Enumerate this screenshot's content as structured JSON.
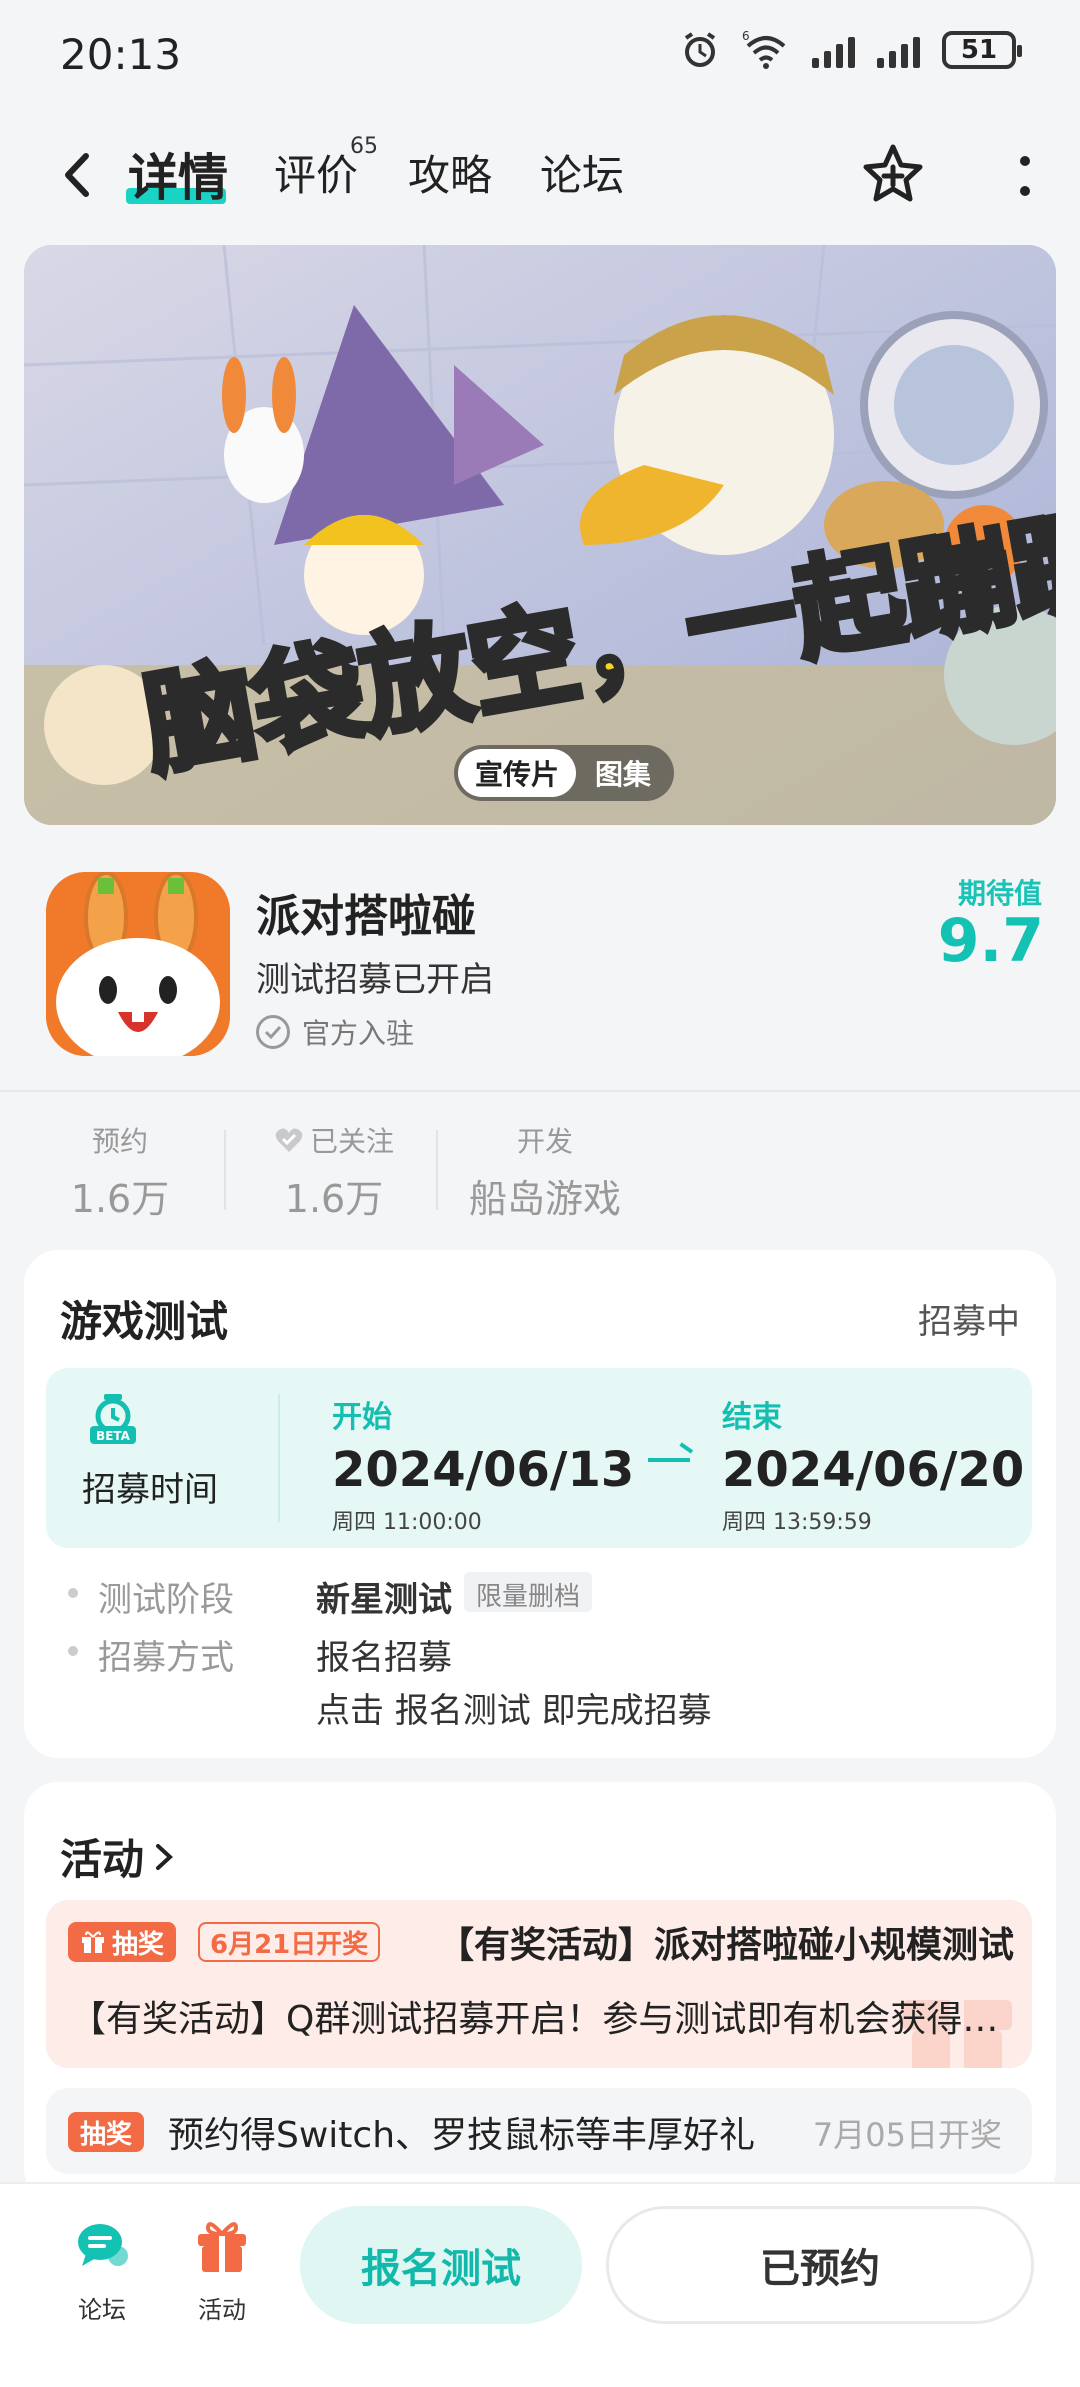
{
  "status_bar": {
    "time": "20:13",
    "battery": "51",
    "wifi_badge": "6"
  },
  "nav": {
    "tabs": [
      {
        "label": "详情"
      },
      {
        "label": "评价"
      },
      {
        "label": "攻略"
      },
      {
        "label": "论坛"
      }
    ],
    "review_count": "65"
  },
  "banner": {
    "slogan": "脑袋放空，一起蹦蹦！",
    "media_tabs": [
      "宣传片",
      "图集"
    ]
  },
  "game": {
    "name": "派对搭啦碰",
    "subtitle": "测试招募已开启",
    "official": "官方入驻",
    "expect_label": "期待值",
    "expect_value": "9.7"
  },
  "stats": {
    "reserve_label": "预约",
    "reserve_value": "1.6万",
    "follow_label": "已关注",
    "follow_value": "1.6万",
    "dev_label": "开发",
    "dev_value": "船岛游戏"
  },
  "test_card": {
    "title": "游戏测试",
    "status": "招募中",
    "beta_label": "BETA",
    "recruit_label": "招募时间",
    "start_head": "开始",
    "start_date": "2024/06/13",
    "start_sub": "周四  11:00:00",
    "end_head": "结束",
    "end_date": "2024/06/20",
    "end_sub": "周四  13:59:59",
    "stage_label": "测试阶段",
    "stage_value": "新星测试",
    "stage_tag": "限量删档",
    "method_label": "招募方式",
    "method_value": "报名招募",
    "method_note": "点击 报名测试 即完成招募"
  },
  "activity_card": {
    "title": "活动",
    "item1": {
      "tag": "抽奖",
      "date_tag": "6月21日开奖",
      "headline": "【有奖活动】派对搭啦碰小规模测试",
      "desc": "【有奖活动】Q群测试招募开启！参与测试即有机会获得奖励"
    },
    "item2": {
      "tag": "抽奖",
      "text": "预约得Switch、罗技鼠标等丰厚好礼",
      "date": "7月05日开奖"
    }
  },
  "bottom_bar": {
    "forum_label": "论坛",
    "activity_label": "活动",
    "signup_label": "报名测试",
    "reserved_label": "已预约"
  },
  "colors": {
    "accent": "#14c2b4",
    "lottery": "#f26b45",
    "activity_bg": "#fdece8",
    "recruit_bg": "#e6f8f6"
  }
}
